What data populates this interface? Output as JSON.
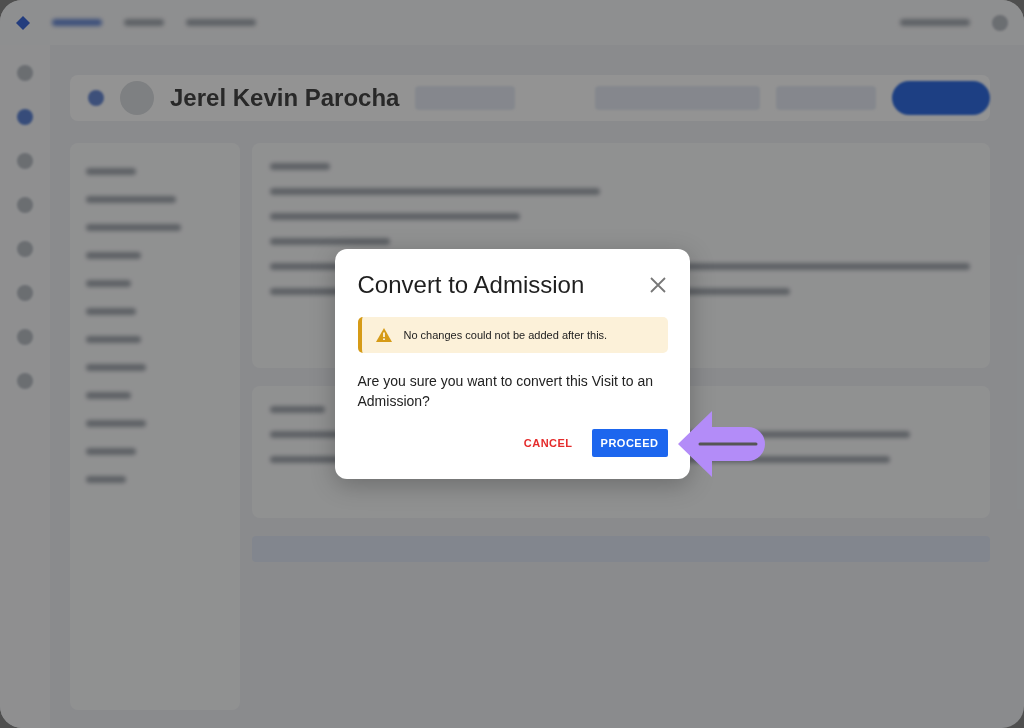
{
  "page": {
    "patient_name": "Jerel Kevin Parocha"
  },
  "dialog": {
    "title": "Convert to Admission",
    "alert": {
      "kind": "warning",
      "text": "No changes could not be added after this."
    },
    "message": "Are you sure you want to convert this Visit to an Admission?",
    "buttons": [
      {
        "label": "CANCEL",
        "kind": "text"
      },
      {
        "label": "PROCEED",
        "kind": "primary"
      }
    ]
  }
}
